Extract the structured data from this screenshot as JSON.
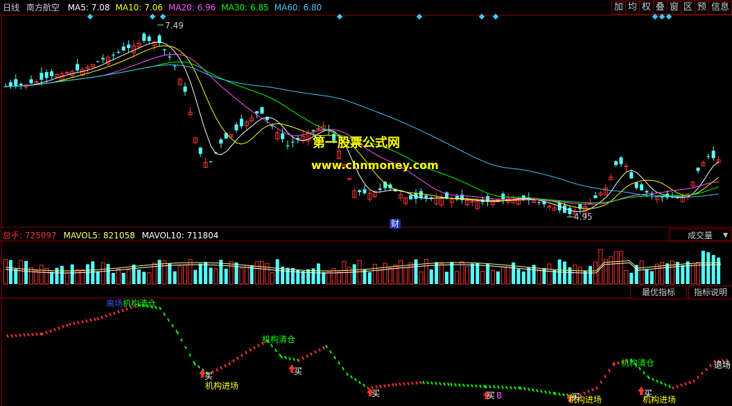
{
  "header": {
    "period": "日线",
    "stock": "南方航空",
    "mas": [
      {
        "label": "MA5: 7.08",
        "color": "#ffffff"
      },
      {
        "label": "MA10: 7.06",
        "color": "#ffff00"
      },
      {
        "label": "MA20: 6.96",
        "color": "#ff55ff"
      },
      {
        "label": "MA30: 6.85",
        "color": "#00ff00"
      },
      {
        "label": "MA60: 6.80",
        "color": "#3cc8ff"
      }
    ],
    "toolbar": [
      "加",
      "均",
      "权",
      "叠",
      "窗",
      "区",
      "预",
      "信息"
    ]
  },
  "price_panel": {
    "high_label": "7.49",
    "low_label": "4.95",
    "badge": "财",
    "watermark1": "第一股票公式网",
    "watermark2": "www.chnmoney.com"
  },
  "volume_panel": {
    "prefix": "总手: ",
    "total": "725097",
    "mavol5": "MAVOL5: 821058",
    "mavol10": "MAVOL10: 711804",
    "dropdown": "成交量",
    "btn_best": "最优指标",
    "btn_help": "指标说明"
  },
  "signals": {
    "top_partial": "离场",
    "clear": "机构清仓",
    "enter": "机构进场",
    "buy": "买",
    "b": "B",
    "exit": "退场"
  },
  "colors": {
    "up": "#ff3232",
    "down": "#54ffff",
    "frame": "#8a0000"
  }
}
